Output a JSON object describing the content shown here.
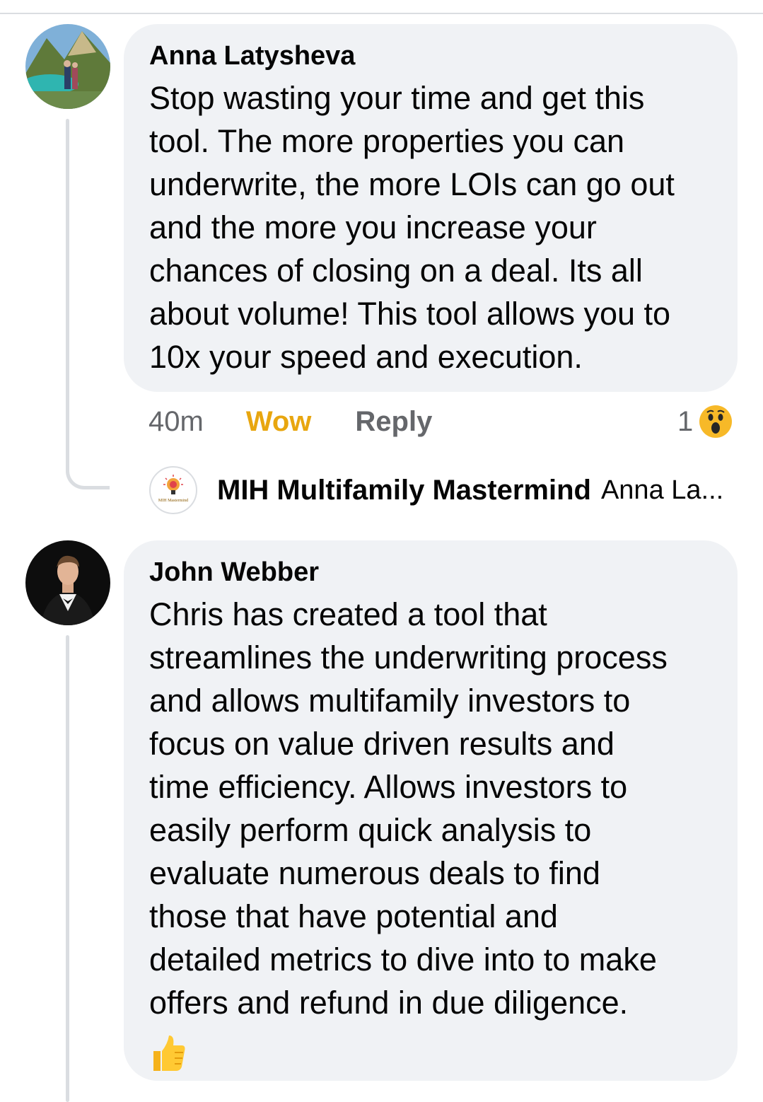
{
  "comments": [
    {
      "author": "Anna Latysheva",
      "text": "Stop wasting your time and get this\ntool. The more properties you can\nunderwrite, the more LOIs can go out\nand the more you increase your\nchances of closing on a deal. Its all\nabout volume! This tool allows you to\n10x your speed and execution.",
      "time": "40m",
      "reaction_label": "Wow",
      "reply_label": "Reply",
      "reaction_count": "1",
      "reaction_icon": "wow-reaction-icon",
      "reply_preview": {
        "author": "MIH Multifamily Mastermind",
        "text": "Anna La...",
        "logo_text": "MIH Mastermind"
      }
    },
    {
      "author": "John Webber",
      "text": "Chris has created a tool that\nstreamlines the underwriting process\nand allows multifamily investors to\nfocus on value driven results and\ntime efficiency. Allows investors to\neasily perform quick analysis to\nevaluate numerous deals to find\nthose that have potential and\ndetailed metrics to dive into to make\noffers and refund in due diligence.",
      "emoji": "thumbs-up-icon"
    }
  ],
  "colors": {
    "bubble": "#f0f2f5",
    "text": "#050505",
    "secondary": "#65676b",
    "wow_label": "#e8a60f",
    "thread_line": "#dadde1"
  }
}
